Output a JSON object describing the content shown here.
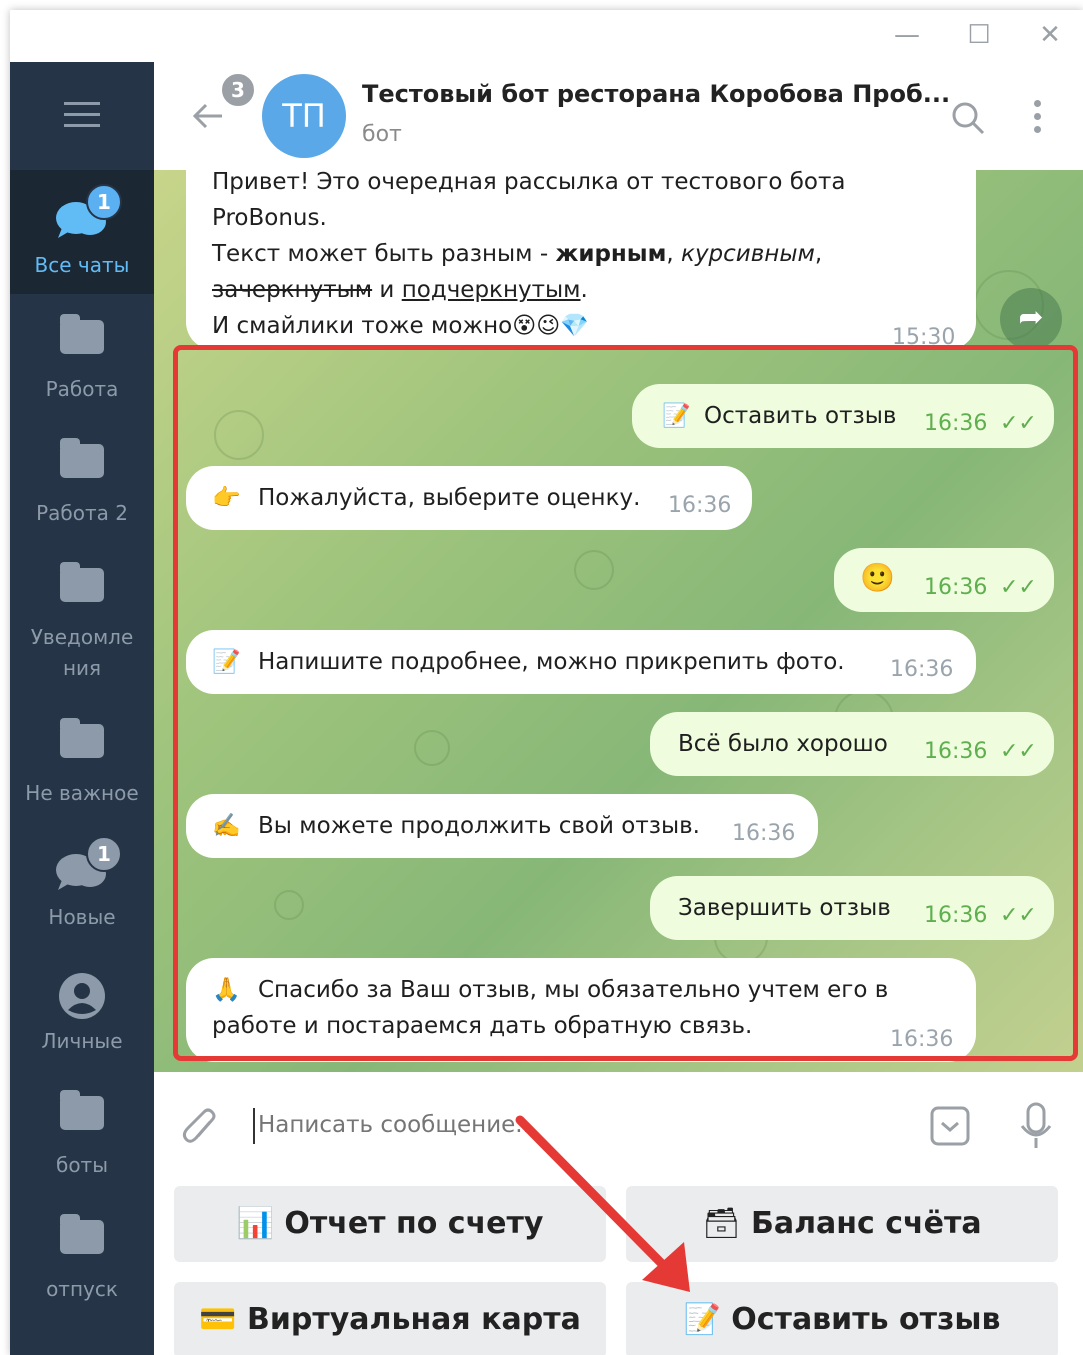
{
  "window": {
    "controls": {
      "minimize": "—",
      "maximize": "☐",
      "close": "✕"
    }
  },
  "sidebar": {
    "menu_icon": "menu-icon",
    "items": [
      {
        "label": "Все чаты",
        "icon": "chats-icon",
        "badge": "1"
      },
      {
        "label": "Работа",
        "icon": "folder-icon"
      },
      {
        "label": "Работа 2",
        "icon": "folder-icon"
      },
      {
        "label": "Уведомле ния",
        "icon": "folder-icon"
      },
      {
        "label": "Не важное",
        "icon": "folder-icon"
      },
      {
        "label": "Новые",
        "icon": "chats-icon",
        "badge": "1"
      },
      {
        "label": "Личные",
        "icon": "person-icon"
      },
      {
        "label": "боты",
        "icon": "folder-icon"
      },
      {
        "label": "отпуск",
        "icon": "folder-icon"
      }
    ]
  },
  "header": {
    "back_badge": "3",
    "avatar_initials": "ТП",
    "title": "Тестовый бот ресторана Коробова Проб...",
    "subtitle": "бот"
  },
  "messages": {
    "broadcast": {
      "line1": "Привет! Это очередная рассылка от тестового бота",
      "line2": "ProBonus.",
      "line3_prefix": "Текст может быть разным - ",
      "line3_bold": "жирным",
      "line3_sep": ", ",
      "line3_italic": "курсивным",
      "line3_end": ",",
      "line4_strike": "зачеркнутым",
      "line4_mid": " и ",
      "line4_underline": "подчеркнутым",
      "line4_end": ".",
      "line5": "И смайлики тоже можно",
      "line5_emoji": "😵😉💎",
      "time": "15:30"
    },
    "m1": {
      "emoji": "📝",
      "text": "Оставить отзыв",
      "time": "16:36",
      "checks": "✓✓"
    },
    "m2": {
      "emoji": "👉",
      "text": "Пожалуйста, выберите оценку.",
      "time": "16:36"
    },
    "m3": {
      "emoji": "🙂",
      "time": "16:36",
      "checks": "✓✓"
    },
    "m4": {
      "emoji": "📝",
      "text": "Напишите подробнее, можно прикрепить фото.",
      "time": "16:36"
    },
    "m5": {
      "text": "Всё было хорошо",
      "time": "16:36",
      "checks": "✓✓"
    },
    "m6": {
      "emoji": "✍️",
      "text": "Вы можете продолжить свой отзыв.",
      "time": "16:36"
    },
    "m7": {
      "text": "Завершить отзыв",
      "time": "16:36",
      "checks": "✓✓"
    },
    "m8": {
      "emoji": "🙏",
      "line1": "Спасибо за Ваш отзыв, мы обязательно учтем его в",
      "line2": "работе и постараемся дать обратную связь.",
      "time": "16:36"
    }
  },
  "input": {
    "placeholder": "Написать сообщение..."
  },
  "keyboard": {
    "b1": {
      "emoji": "📊",
      "label": "Отчет по счету"
    },
    "b2": {
      "emoji": "🗃",
      "label": "Баланс счёта"
    },
    "b3": {
      "emoji": "💳",
      "label": "Виртуальная карта"
    },
    "b4": {
      "emoji": "📝",
      "label": "Оставить отзыв"
    }
  },
  "colors": {
    "sidebar_bg": "#253446",
    "accent": "#5aa8e8",
    "annotation_red": "#e53935",
    "out_bubble": "#effdde"
  }
}
